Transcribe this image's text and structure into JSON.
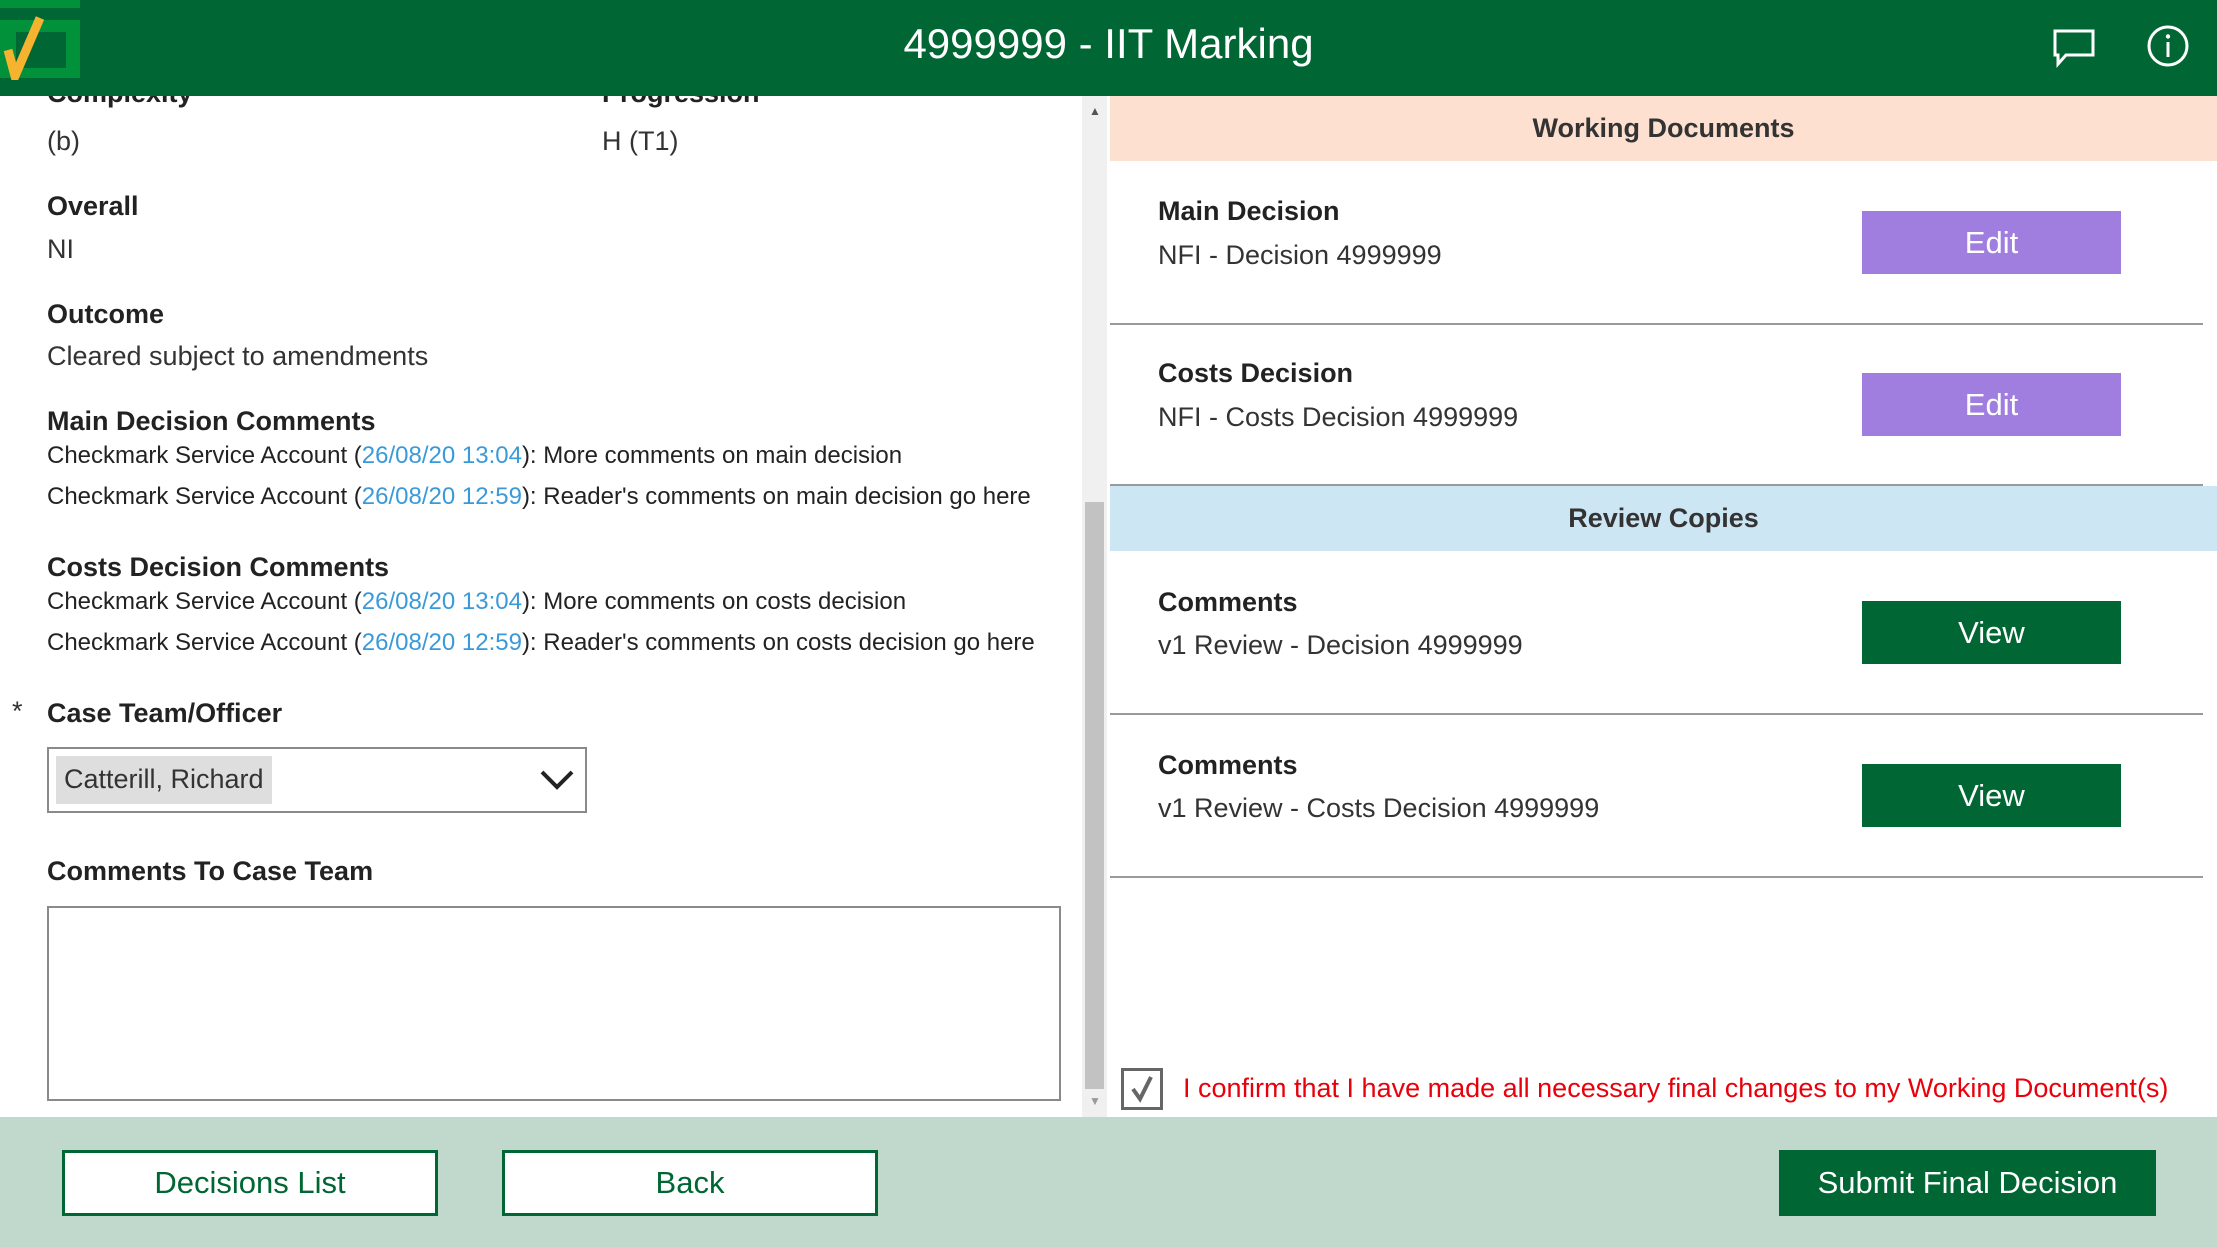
{
  "header": {
    "title": "4999999 - IIT Marking",
    "logo_icon": "checkmark-logo-icon",
    "chat_icon": "comment-icon",
    "info_icon": "info-icon"
  },
  "left": {
    "complexity": {
      "label": "Complexity",
      "value": "(b)"
    },
    "progression": {
      "label": "Progression",
      "value": "H (T1)"
    },
    "overall": {
      "label": "Overall",
      "value": "NI"
    },
    "outcome": {
      "label": "Outcome",
      "value": "Cleared subject to amendments"
    },
    "main_comments": {
      "label": "Main Decision Comments",
      "items": [
        {
          "author": "Checkmark Service Account (",
          "time": "26/08/20 13:04",
          "text": "): More comments on main decision"
        },
        {
          "author": "Checkmark Service Account (",
          "time": "26/08/20 12:59",
          "text": "): Reader's comments on main decision go here"
        }
      ]
    },
    "costs_comments": {
      "label": "Costs Decision Comments",
      "items": [
        {
          "author": "Checkmark Service Account (",
          "time": "26/08/20 13:04",
          "text": "): More comments on costs decision"
        },
        {
          "author": "Checkmark Service Account (",
          "time": "26/08/20 12:59",
          "text": "): Reader's comments on costs decision go here"
        }
      ]
    },
    "case_team": {
      "required": "*",
      "label": "Case Team/Officer",
      "value": "Catterill, Richard"
    },
    "comments_to_team": {
      "label": "Comments To Case Team",
      "value": ""
    }
  },
  "right": {
    "working_docs": {
      "title": "Working Documents",
      "items": [
        {
          "title": "Main Decision",
          "doc": "NFI - Decision 4999999",
          "button": "Edit"
        },
        {
          "title": "Costs Decision",
          "doc": "NFI - Costs Decision 4999999",
          "button": "Edit"
        }
      ]
    },
    "review_copies": {
      "title": "Review Copies",
      "items": [
        {
          "title": "Comments",
          "doc": "v1 Review - Decision 4999999",
          "button": "View"
        },
        {
          "title": "Comments",
          "doc": "v1 Review - Costs Decision 4999999",
          "button": "View"
        }
      ]
    },
    "confirm": {
      "checked": true,
      "text": "I confirm that I have made all necessary final changes to my Working Document(s)"
    }
  },
  "footer": {
    "decisions_list": "Decisions List",
    "back": "Back",
    "submit": "Submit Final Decision"
  },
  "colors": {
    "brand": "#006633",
    "edit": "#a07ee0",
    "footer": "#c0d9cc",
    "confirm": "#e8000b"
  }
}
